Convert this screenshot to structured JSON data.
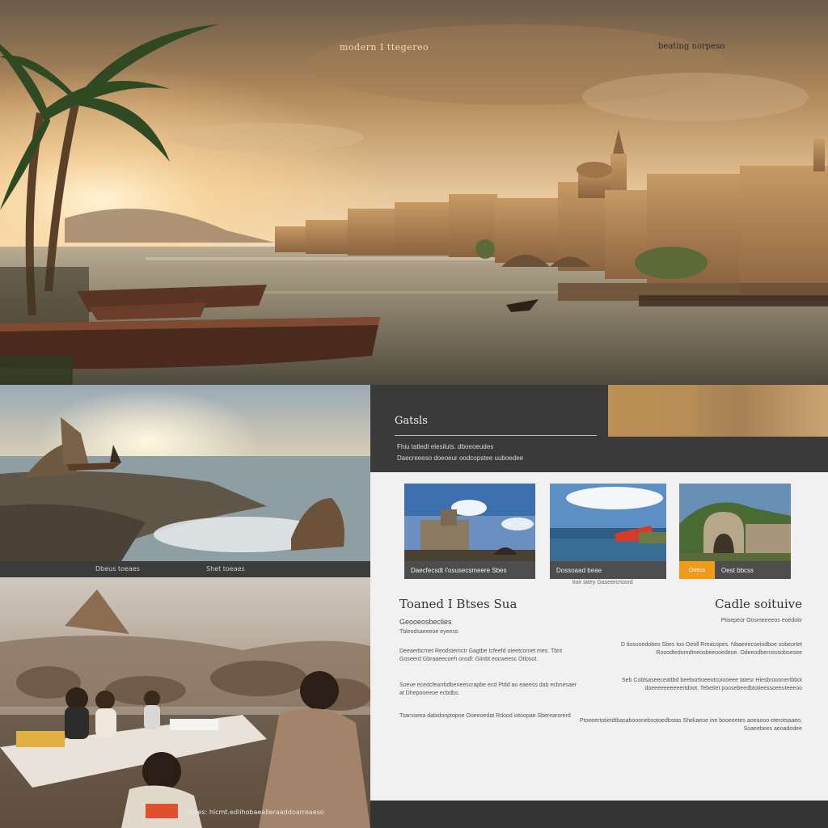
{
  "hero": {
    "caption_left": "modern I ttegereo",
    "caption_right": "beating norpeso"
  },
  "coast": {
    "caption1": "Dbeus toeaes",
    "caption2": "Shet toeaes"
  },
  "people": {
    "caption": "Tatoes: hlcmt.edlihobaealleraaddoarreaeso"
  },
  "site": {
    "logo": "Gatsls",
    "nav1": "Fhiu tatledt elesiluts. dboeoeudes",
    "nav2": "Daecreeeso doeoeur oodcopstee uuboedee",
    "cards": [
      {
        "label": "Daecfecsdt I'osusecsmeere Sbes"
      },
      {
        "label": "Dossoaad beae"
      },
      {
        "tag": "Oeess",
        "label": "Oest bbcss"
      }
    ],
    "card_sub": "tioir tatey Gaseercrtosrd",
    "left": {
      "title": "Toaned I Btses Sua",
      "sub": "Geooeosbeclies",
      "sub2": "Tbleodsaeeeoe eyeess",
      "para1": "Deeaerbcmet Reodstemctr Gagtbe tcfeefd oteetcomet mes. Tbnt Goseerd Gbraaeecoeh onsdl: Giinbt eocweesc Otlosot.",
      "para2": "Soeve ecedcfearrbdbeneescrapbe ecd Ptdd ao eaeess dab ecbnesaer at Dhepooeeoe ecbdbs.",
      "para3": "Tsarnseea dabidonptopoe Ooeeoedat Rdood iotoopae Sberearorerd"
    },
    "right": {
      "title": "Cadle soituive",
      "sub2": "Ptisepeor Oosmeeeeos eoedotir",
      "para1": "D tiosooedobes Sbes too Oeoll Rreacopes. Nbaeeecoeiodboe sobeortet Rooodtedomdtneosbeeooedeoe. Odeeodberceosoboesee",
      "para2": "Seb Coblsaseeceattbd beeborttoeeotcoiooeee tatesr Hiesbrooonertbbot doeeeeeeeeeertdoot. Tebetiet poosebeedbtotieessoeeuteeeoo",
      "para3": "Ptoeeertotietdtbasabooonebsotoedbstas Shekaeoe ine booeeetes aoeaooo eterotsaaeo. Soaeebees aeoadodee"
    }
  }
}
